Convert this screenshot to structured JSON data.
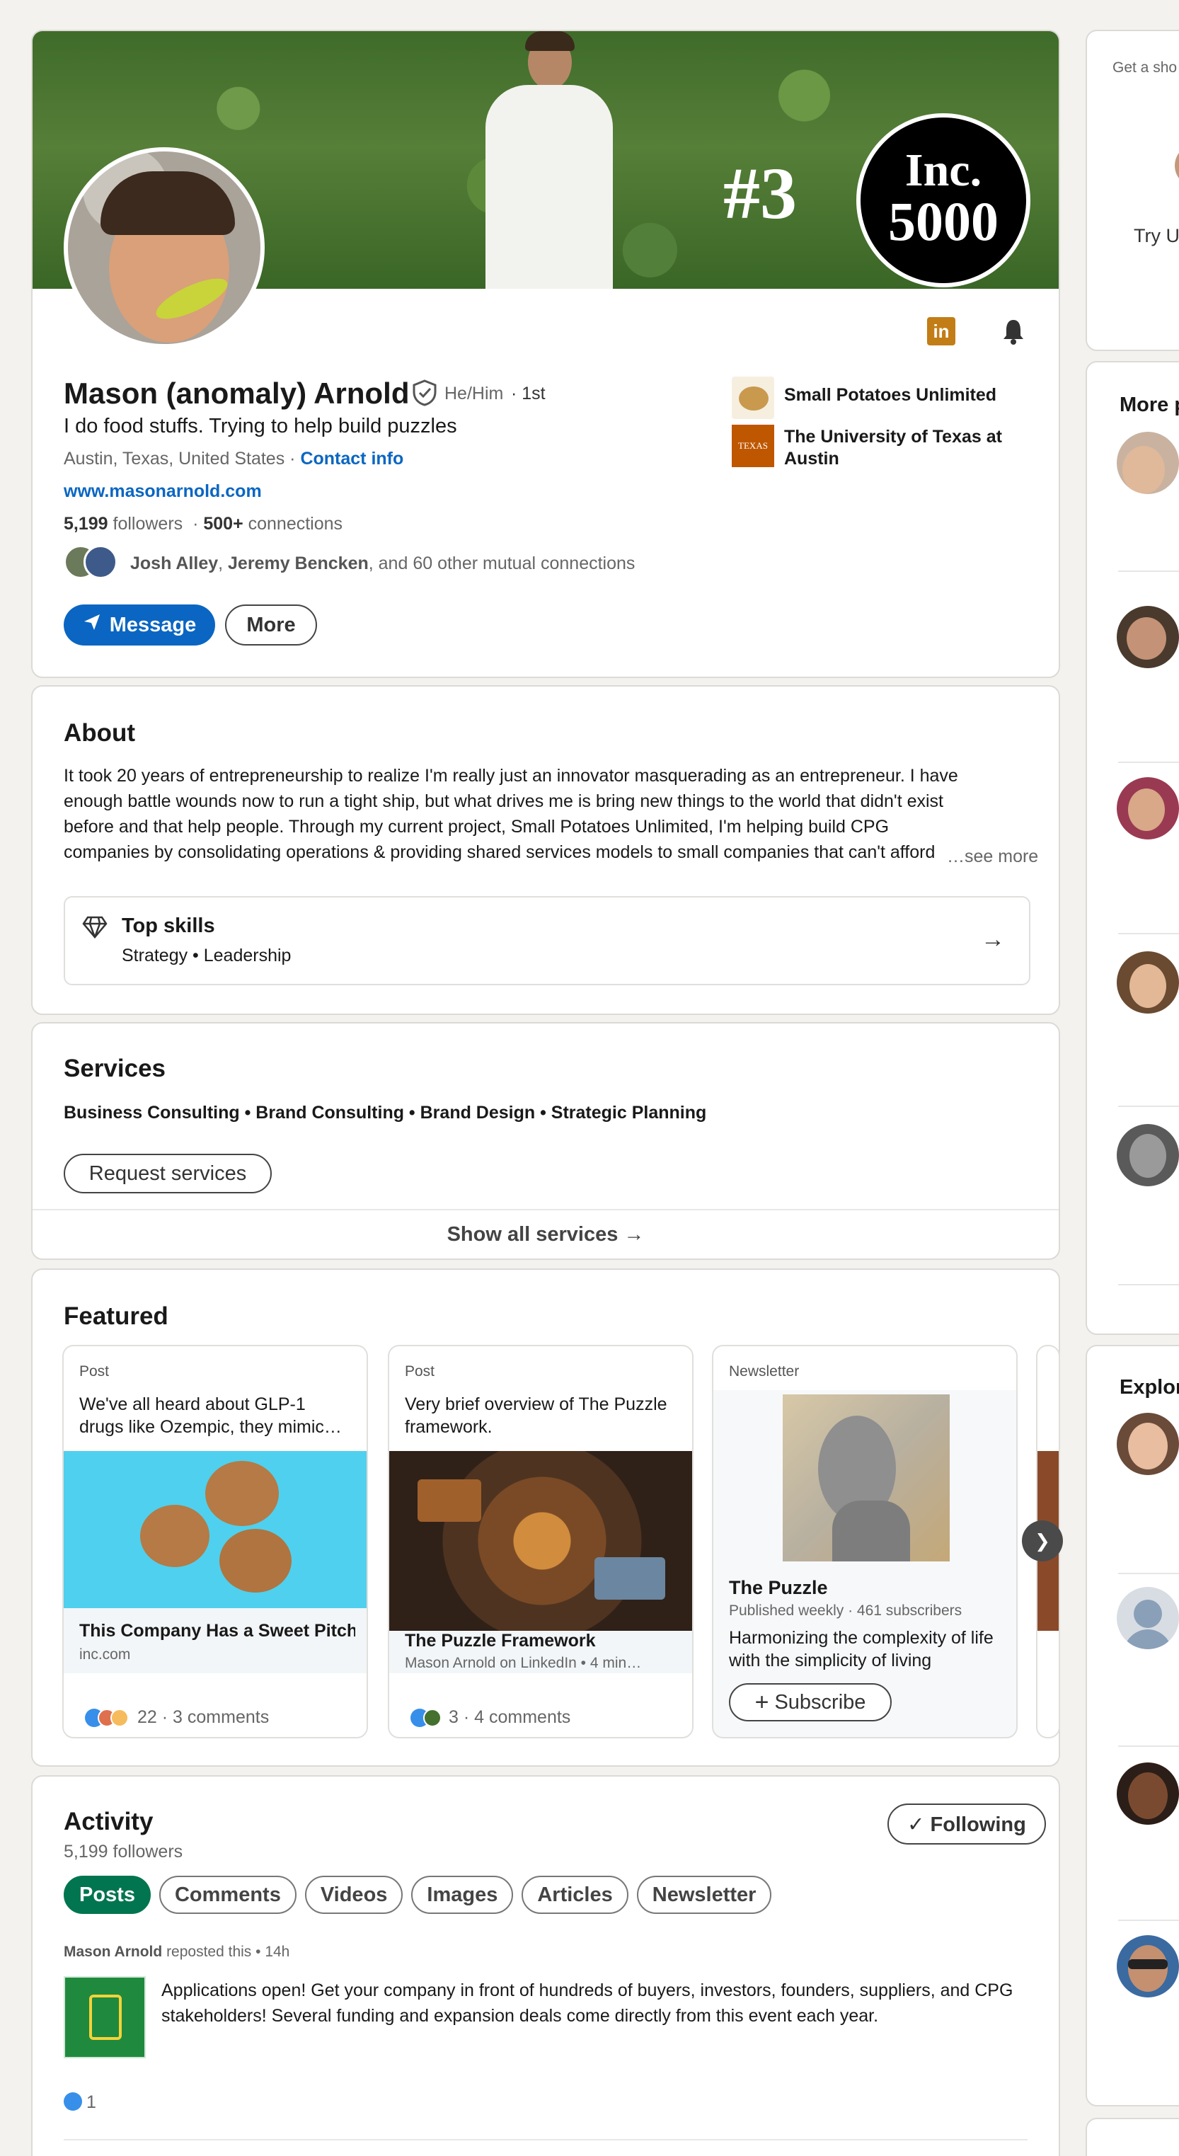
{
  "profile": {
    "cover_caption_rank": "#3",
    "cover_caption_brand": "Inc.",
    "cover_caption_brand_number": "5000",
    "name": "Mason (anomaly) Arnold",
    "pronouns": "He/Him",
    "degree": "· 1st",
    "headline": "I do food stuffs. Trying to help build puzzles",
    "location": "Austin, Texas, United States",
    "location_separator": "·",
    "contact_info": "Contact info",
    "website": "www.masonarnold.com",
    "followers_count": "5,199",
    "followers_label": "followers",
    "connections_dot": "·",
    "connections_count": "500+",
    "connections_label": "connections",
    "mutual_name_1": "Josh Alley",
    "mutual_sep": ",",
    "mutual_name_2": "Jeremy Bencken",
    "mutual_rest": ", and 60 other mutual connections",
    "message_button": "Message",
    "more_button": "More",
    "company_1": "Small Potatoes Unlimited",
    "company_2": "The University of Texas at Austin",
    "company_2_logo_text": "TEXAS"
  },
  "about": {
    "title": "About",
    "text": "It took 20 years of entrepreneurship to realize I'm really just an innovator masquerading as an entrepreneur. I have enough battle wounds now to run a tight ship, but what drives me is bring new things to the world that didn't exist before and that help people. Through my current project, Small Potatoes Unlimited, I'm helping build CPG companies by consolidating operations & providing shared services models to small companies that can't afford exp",
    "see_more": "…see more",
    "top_skills_title": "Top skills",
    "top_skills": "Strategy • Leadership"
  },
  "services": {
    "title": "Services",
    "list": "Business Consulting • Brand Consulting • Brand Design • Strategic Planning",
    "request_button": "Request services",
    "show_all": "Show all services →"
  },
  "featured": {
    "title": "Featured",
    "items": [
      {
        "kind": "Post",
        "title": "We've all heard about GLP-1 drugs like Ozempic, they mimic…",
        "link_title": "This Company Has a Sweet Pitch: A Healthier Cookie Tha…",
        "link_source": "inc.com",
        "reactions": "22",
        "comments": "· 3 comments"
      },
      {
        "kind": "Post",
        "title": "Very brief overview of The Puzzle framework.",
        "link_title": "The Puzzle Framework",
        "link_source": "Mason Arnold on LinkedIn • 4 min…",
        "reactions": "3",
        "comments": "· 4 comments"
      },
      {
        "kind": "Newsletter",
        "title": "The Puzzle",
        "subtitle": "Published weekly · 461 subscribers",
        "desc": "Harmonizing the complexity of life with the simplicity of living",
        "subscribe": "Subscribe"
      }
    ],
    "next_arrow": "❯"
  },
  "activity": {
    "title": "Activity",
    "followers": "5,199 followers",
    "following_button": "✓ Following",
    "tabs": [
      "Posts",
      "Comments",
      "Videos",
      "Images",
      "Articles",
      "Newsletter"
    ],
    "post_author": "Mason Arnold",
    "post_meta": "reposted this • 14h",
    "post_text": "Applications open! Get your company in front of hundreds of buyers, investors, founders, suppliers, and CPG stakeholders! Several funding and expansion deals come directly from this event each year.",
    "post_reactions": "1"
  },
  "sidebar": {
    "promo_text": "Get a sho",
    "try_text": "Try U",
    "more_title": "More p",
    "explore_title": "Explor"
  },
  "colors": {
    "brand_blue": "#0a66c2",
    "active_green": "#01754f",
    "linkedin_orange": "#c37d16"
  }
}
